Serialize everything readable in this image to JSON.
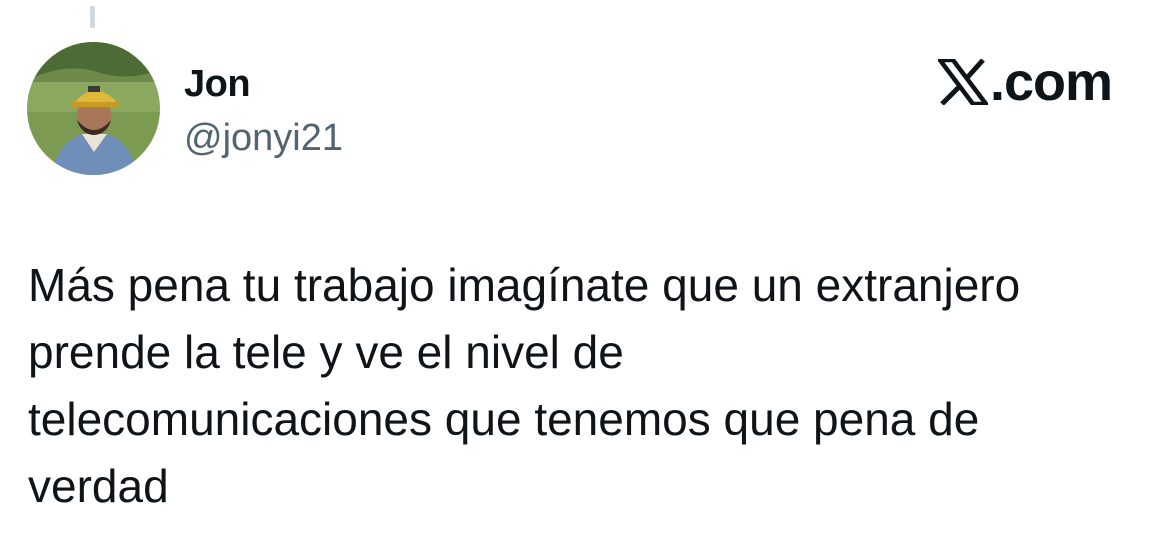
{
  "tweet": {
    "author": {
      "display_name": "Jon",
      "handle": "@jonyi21",
      "avatar_icon": "profile-photo"
    },
    "brand": {
      "icon": "x-logo-icon",
      "label": ".com"
    },
    "text": "Más pena tu trabajo imagínate que un extranjero\nprende la tele y ve el nivel de\ntelecomunicaciones que tenemos que pena de\nverdad"
  },
  "colors": {
    "text_primary": "#0f1419",
    "text_secondary": "#536471",
    "thread_line": "#cfd9de",
    "background": "#ffffff"
  }
}
